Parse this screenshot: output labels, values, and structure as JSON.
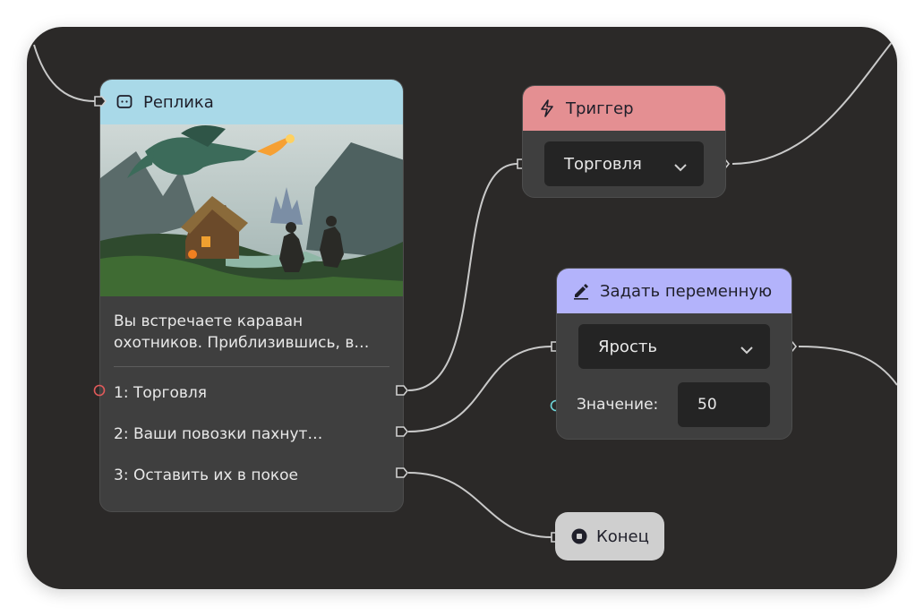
{
  "colors": {
    "canvas": "#2b2928",
    "dialog_header": "#a9d9e8",
    "trigger_header": "#e48f92",
    "setvar_header": "#b3b3fb",
    "end_node": "#cfcfcf",
    "node_body": "#3f3f3f",
    "choice_port_accent": "#e05a5a",
    "value_port_accent": "#6fd6d9"
  },
  "dialog_node": {
    "icon": "chat-bubble-icon",
    "title": "Реплика",
    "image": "dragon-caravan-illustration",
    "text": "Вы встречаете караван охотников. Приблизившись, в…",
    "choices": [
      {
        "label": "1: Торговля"
      },
      {
        "label": "2: Ваши повозки пахнут…"
      },
      {
        "label": "3: Оставить их в покое"
      }
    ]
  },
  "trigger_node": {
    "icon": "lightning-icon",
    "title": "Триггер",
    "select_value": "Торговля"
  },
  "set_variable_node": {
    "icon": "pencil-icon",
    "title": "Задать переменную",
    "select_value": "Ярость",
    "value_label": "Значение:",
    "value": "50"
  },
  "end_node": {
    "icon": "stop-circle-icon",
    "title": "Конец"
  }
}
